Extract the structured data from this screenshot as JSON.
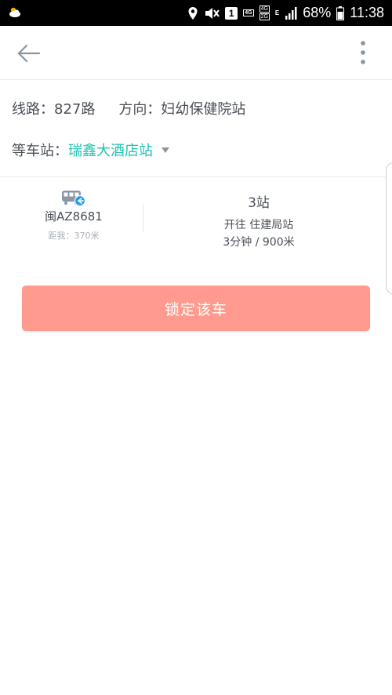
{
  "status_bar": {
    "time": "11:38",
    "battery": "68%",
    "net_4g": "4G",
    "net_4g_sub": "4G",
    "net_2g": "2G",
    "network_e": "E",
    "sim_slot": "1",
    "icons": [
      "cloud-icon",
      "location-icon",
      "mute-icon",
      "sim-icon",
      "signal-icon",
      "battery-icon"
    ]
  },
  "header": {
    "back_icon": "arrow-left-icon",
    "more_icon": "more-vertical-icon"
  },
  "route": {
    "line_label": "线路：",
    "line_value": "827路",
    "direction_label": "方向：",
    "direction_value": "妇幼保健院站"
  },
  "station": {
    "label": "等车站：",
    "name": "瑞鑫大酒店站"
  },
  "bus": {
    "plate": "闽AZ8681",
    "distance": "距我：370米",
    "stops": "3站",
    "heading": "开往 住建局站",
    "eta": "3分钟 / 900米"
  },
  "actions": {
    "lock_label": "锁定该车"
  },
  "colors": {
    "accent": "#21c2b4",
    "button": "#ff9b8e",
    "text": "#4a4f57",
    "muted": "#a7acb2",
    "bus_icon": "#8a97a8",
    "bus_badge": "#1e9be8"
  }
}
